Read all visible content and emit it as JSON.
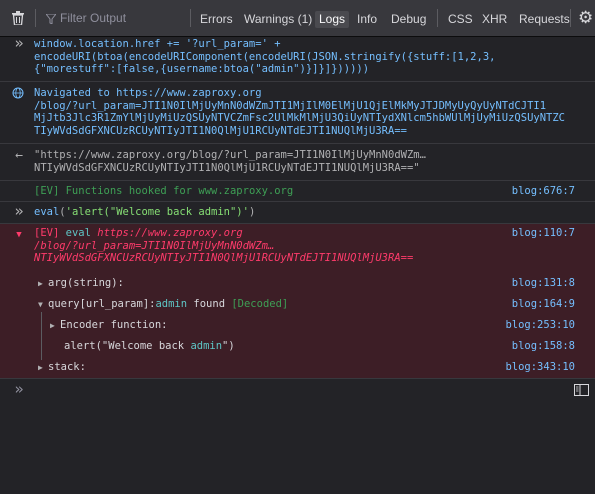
{
  "toolbar": {
    "filter_placeholder": "Filter Output",
    "tabs": [
      "Errors",
      "Warnings (1)",
      "Logs",
      "Info",
      "Debug",
      "CSS",
      "XHR",
      "Requests"
    ],
    "active_tab": "Logs"
  },
  "rows": {
    "input1": {
      "line1": "window.location.href += '?url_param=' +",
      "line2": "encodeURI(btoa(encodeURIComponent(encodeURI(JSON.stringify({stuff:[1,2,3,",
      "line3": "{\"morestuff\":[false,{username:btoa(\"admin\")}]}]})))))"
    },
    "nav": {
      "line1": "Navigated to https://www.zaproxy.org",
      "line2": "/blog/?url_param=JTI1N0IlMjUyMnN0dWZmJTI1MjIlM0ElMjU1QjElMkMyJTJDMyUyQyUyNTdCJTI1",
      "line3": "MjJtb3Jlc3R1ZmYlMjUyMiUzQSUyNTVCZmFsc2UlMkMlMjU3QiUyNTIydXNlcm5hbWUlMjUyMiUzQSUyNTZC",
      "line4": "TIyWVdSdGFXNCUzRCUyNTIyJTI1N0QlMjU1RCUyNTdEJTI1NUQlMjU3RA=="
    },
    "result": {
      "line1": "\"https://www.zaproxy.org/blog/?url_param=JTI1N0IlMjUyMnN0dWZm…",
      "line2": "NTIyWVdSdGFXNCUzRCUyNTIyJTI1N0QlMjU1RCUyNTdEJTI1NUQlMjU3RA==\""
    },
    "ev_hooked": {
      "prefix": "[EV] Functions hooked for ",
      "host": "www.zaproxy.org",
      "location": "blog:676:7"
    },
    "input2": {
      "fn": "eval",
      "open": "(",
      "arg": "'alert(\"Welcome back admin\")'",
      "close": ")"
    },
    "ev_eval": {
      "tag": "[EV]",
      "fn": "eval",
      "url1": "https://www.zaproxy.org",
      "url2": "/blog/?url_param=JTI1N0IlMjUyMnN0dWZm…",
      "url3": "NTIyWVdSdGFXNCUzRCUyNTIyJTI1N0QlMjU1RCUyNTdEJTI1NUQlMjU3RA==",
      "location": "blog:110:7"
    },
    "tree": {
      "arg_label": "arg(string):",
      "arg_loc": "blog:131:8",
      "query_key": "query[url_param]:",
      "query_name": "admin",
      "query_found": "found",
      "query_decoded": "[Decoded]",
      "query_loc": "blog:164:9",
      "encoder_label": "Encoder function:",
      "encoder_loc": "blog:253:10",
      "alert_pre": "alert(\"Welcome back ",
      "alert_name": "admin",
      "alert_post": "\")",
      "alert_loc": "blog:158:8",
      "stack_label": "stack:",
      "stack_loc": "blog:343:10"
    }
  },
  "icons": {
    "trash": "trash-icon",
    "filter": "filter-icon",
    "settings": "gear-icon",
    "prompt": "prompt-chevron-icon",
    "navigate": "globe-icon",
    "result": "return-arrow-icon",
    "error": "error-chevron-icon",
    "sidebar": "split-console-icon"
  },
  "colors": {
    "background": "#232327",
    "toolbar": "#38383d",
    "accent_blue": "#75bfff",
    "error_red": "#ff3b6b",
    "keyword_pink": "#ff7de9",
    "string_green": "#86de74",
    "ev_green": "#3e9f55"
  }
}
